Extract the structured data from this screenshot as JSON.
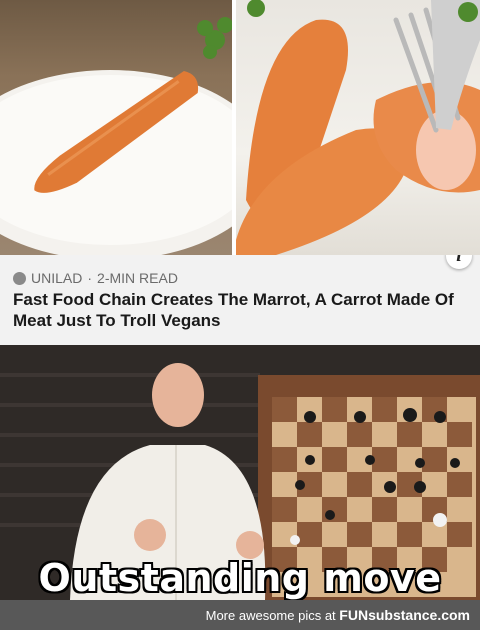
{
  "article": {
    "source": "UNILAD",
    "separator": "·",
    "read_time": "2-MIN READ",
    "headline": "Fast Food Chain Creates The Marrot, A Carrot Made Of Meat Just To Troll Vegans",
    "info_icon": "info-icon"
  },
  "meme": {
    "caption": "Outstanding move"
  },
  "footer": {
    "prefix": "More awesome pics at",
    "brand": "FUNsubstance.com"
  },
  "colors": {
    "card_bg": "#f2f2f2",
    "footer_bg": "#585858",
    "carrot": "#e07a35"
  }
}
